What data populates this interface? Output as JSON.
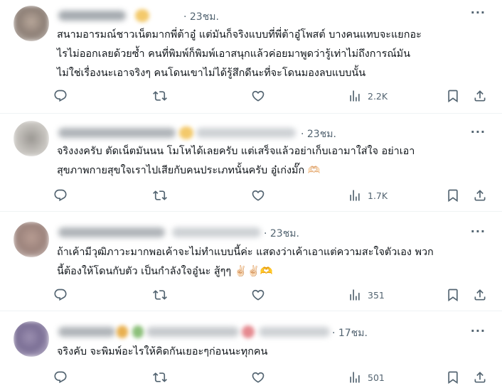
{
  "tweets": [
    {
      "time": "· 23ชม.",
      "lines": [
        "สนามอารมณ์ชาวเน็ตมากพี่ต้าอู๋ แต่มันก็จริงแบบที่พี่ต้าอู๋โพสต์ บางคนแทบจะแยกอะ",
        "ไรไม่ออกเลยด้วยซ้ำ คนที่พิมพ์ก็พิมพ์เอาสนุกแล้วค่อยมาพูดว่ารู้เท่าไม่ถึงการณ์มัน",
        "ไม่ใช่เรื่องนะเอาจริงๆ คนโดนเขาไม่ได้รู้สึกดีนะที่จะโดนมองลบแบบนั้น"
      ],
      "views": "2.2K"
    },
    {
      "time": "· 23ชม.",
      "lines": [
        "จริงงงครับ ตัดเน็ตมันนน โมโหได้เลยครับ แต่เสร็จแล้วอย่าเก็บเอามาใส่ใจ อย่าเอา",
        "สุขภาพกายสุขใจเราไปเสียกับคนประเภทนั้นครับ อู๋เก่งมั๊ก 🫶🏻"
      ],
      "views": "1.7K"
    },
    {
      "time": "· 23ชม.",
      "lines": [
        "ถ้าเค้ามีวุฒิภาวะมากพอเค้าจะไม่ทำแบบนี้ค่ะ แสดงว่าเค้าเอาแต่ความสะใจตัวเอง พวก",
        "นี้ต้องให้โดนกับตัว เป็นกำลังใจอู๋นะ สู้ๆๆ ✌🏻✌🏻🫶"
      ],
      "views": "351"
    },
    {
      "time": "· 17ชม.",
      "lines": [
        "จริงคับ จะพิมพ์อะไรให้คิดกันเยอะๆก่อนนะทุกคน"
      ],
      "views": "501"
    }
  ],
  "icons": {
    "reply": "reply-icon",
    "retweet": "retweet-icon",
    "like": "heart-icon",
    "views": "views-bar-chart-icon",
    "bookmark": "bookmark-icon",
    "share": "share-icon",
    "more": "more-options-icon"
  },
  "colors": {
    "text": "#0f1419",
    "secondary": "#536471",
    "divider": "#eff3f4"
  }
}
